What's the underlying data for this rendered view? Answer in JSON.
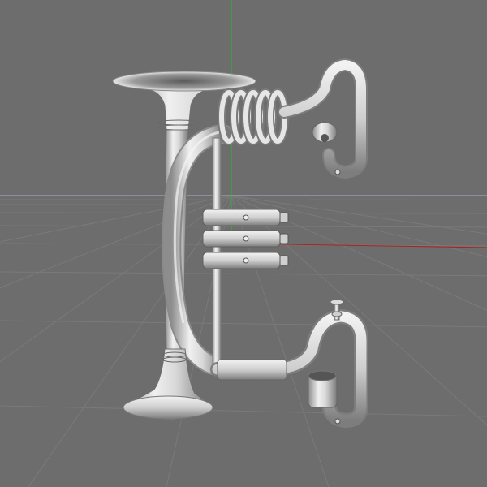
{
  "viewport": {
    "background": "#6d6d6d",
    "grid_color": "#7a7a7a",
    "horizon_color": "#8a8f98",
    "axis_y_color": "#22c322",
    "axis_x_color": "#b02020"
  },
  "model": {
    "object": "horn-with-valves",
    "material_color": "#dedede"
  }
}
